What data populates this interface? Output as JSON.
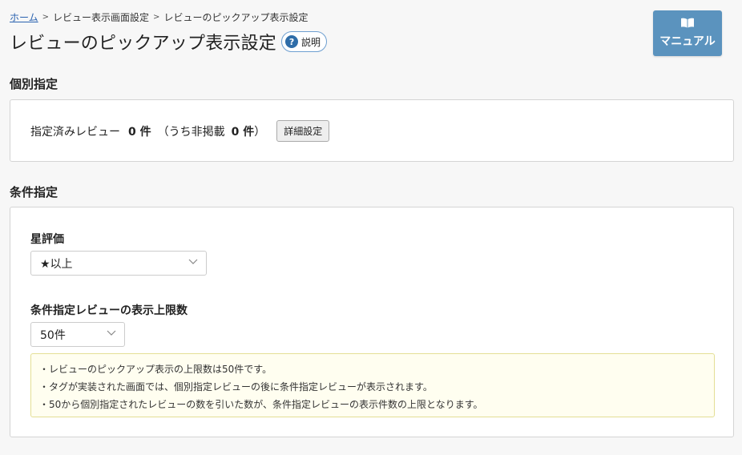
{
  "breadcrumb": {
    "home": "ホーム",
    "items": [
      "レビュー表示画面設定",
      "レビューのピックアップ表示設定"
    ]
  },
  "page": {
    "title": "レビューのピックアップ表示設定",
    "help_label": "説明",
    "manual_label": "マニュアル"
  },
  "individual": {
    "heading": "個別指定",
    "label": "指定済みレビュー",
    "count": "0 件",
    "paren_label": "（うち非掲載",
    "hidden_count": "0 件",
    "paren_close": "）",
    "detail_button": "詳細設定"
  },
  "condition": {
    "heading": "条件指定",
    "rating_label": "星評価",
    "rating_value": "★以上",
    "limit_label": "条件指定レビューの表示上限数",
    "limit_value": "50件",
    "notes": [
      "レビューのピックアップ表示の上限数は50件です。",
      "タグが実装された画面では、個別指定レビューの後に条件指定レビューが表示されます。",
      "50から個別指定されたレビューの数を引いた数が、条件指定レビューの表示件数の上限となります。"
    ]
  },
  "colors": {
    "accent": "#5b93be",
    "link": "#2a62b0",
    "notice_bg": "#fffef0",
    "notice_border": "#e4df95"
  }
}
